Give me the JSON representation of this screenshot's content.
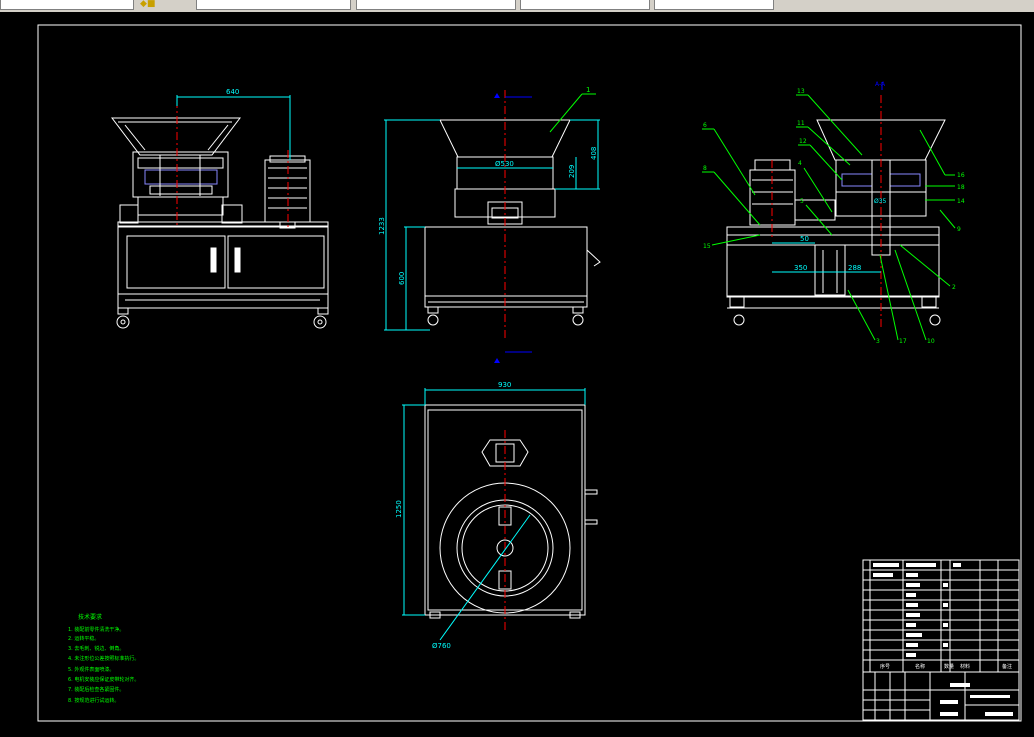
{
  "tabs": [
    {
      "label": "",
      "active": false
    },
    {
      "label": "",
      "active": false
    },
    {
      "label": "",
      "active": false
    },
    {
      "label": "",
      "active": false
    },
    {
      "label": "",
      "active": false
    }
  ],
  "dimensions": {
    "front_width": "640",
    "side_total_height": "1233",
    "side_base_height": "600",
    "side_hopper_height": "408",
    "side_upper_height": "209",
    "side_diameter": "Ø530",
    "section_50": "50",
    "section_350": "350",
    "section_288": "288",
    "section_dim": "Ø35",
    "top_width": "930",
    "top_depth": "1250",
    "top_diameter": "Ø760"
  },
  "part_labels": [
    "1",
    "13",
    "11",
    "12",
    "4",
    "5",
    "6",
    "8",
    "15",
    "16",
    "18",
    "14",
    "9",
    "2",
    "3",
    "17",
    "10"
  ],
  "notes": {
    "title": "技术要求",
    "lines": [
      "1. 装配前零件清洗干净。",
      "2. 运转平稳。",
      "3. 去毛刺、锐边、倒角。",
      "4. 未注形位公差按照标准执行。",
      "5. 外观件表面喷漆。",
      "6. 电机安装应保证皮带轮对齐。",
      "7. 装配后检查各紧固件。",
      "8. 按规范进行试运转。"
    ]
  },
  "title_block": {
    "headers": [
      "序号",
      "名称",
      "数量",
      "材料",
      "备注"
    ]
  },
  "colors": {
    "background": "#000000",
    "outline": "#ffffff",
    "centerline": "#ff0000",
    "dimension": "#00ffff",
    "leader": "#00ff00",
    "marker": "#0000ff",
    "notes_text": "#00ff00"
  }
}
